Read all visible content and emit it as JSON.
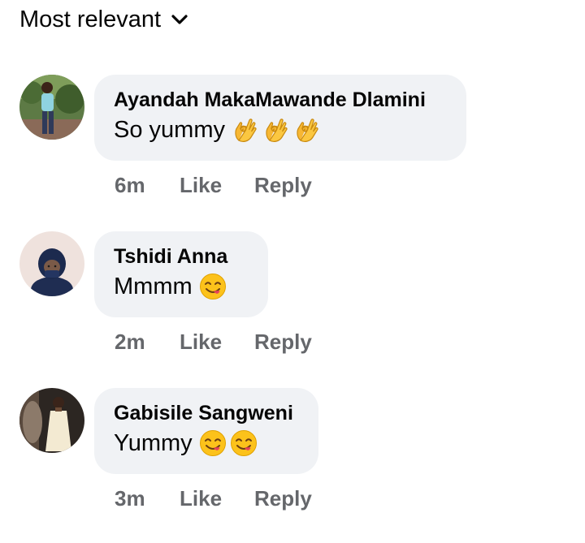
{
  "sort": {
    "label": "Most relevant",
    "icon": "chevron-down-icon"
  },
  "comments": [
    {
      "author": "Ayandah MakaMawande Dlamini",
      "text": "So yummy",
      "emojis": [
        "ok-hand",
        "ok-hand",
        "ok-hand"
      ],
      "time": "6m",
      "like": "Like",
      "reply": "Reply"
    },
    {
      "author": "Tshidi Anna",
      "text": "Mmmm",
      "emojis": [
        "face-savoring-food"
      ],
      "time": "2m",
      "like": "Like",
      "reply": "Reply"
    },
    {
      "author": "Gabisile Sangweni",
      "text": "Yummy",
      "emojis": [
        "face-savoring-food",
        "face-savoring-food"
      ],
      "time": "3m",
      "like": "Like",
      "reply": "Reply"
    }
  ],
  "colors": {
    "bubble": "#f0f2f5",
    "meta": "#65676b",
    "text": "#050505"
  }
}
